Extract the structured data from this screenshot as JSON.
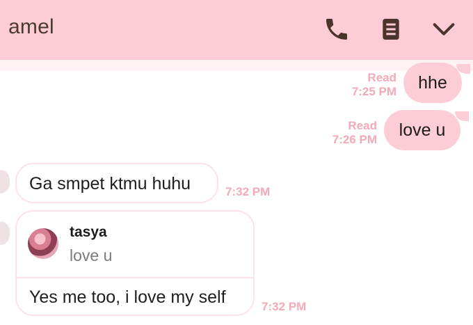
{
  "header": {
    "title": "amel",
    "icons": [
      "phone-icon",
      "notes-icon",
      "chevron-down-icon"
    ],
    "color": "#fccdd6"
  },
  "messages": [
    {
      "direction": "out",
      "text": "hhe",
      "status": "Read",
      "time": "7:25 PM"
    },
    {
      "direction": "out",
      "text": "love u",
      "status": "Read",
      "time": "7:26 PM"
    },
    {
      "direction": "in",
      "text": "Ga smpet ktmu huhu",
      "time": "7:32 PM"
    },
    {
      "direction": "in",
      "reply_to": {
        "name": "tasya",
        "text": "love u"
      },
      "text": "Yes me too, i love my self",
      "time": "7:32 PM"
    }
  ],
  "colors": {
    "outgoing_bubble": "#fccdd6",
    "meta_text": "#f3a9b8",
    "incoming_border": "#fbe3e8"
  }
}
